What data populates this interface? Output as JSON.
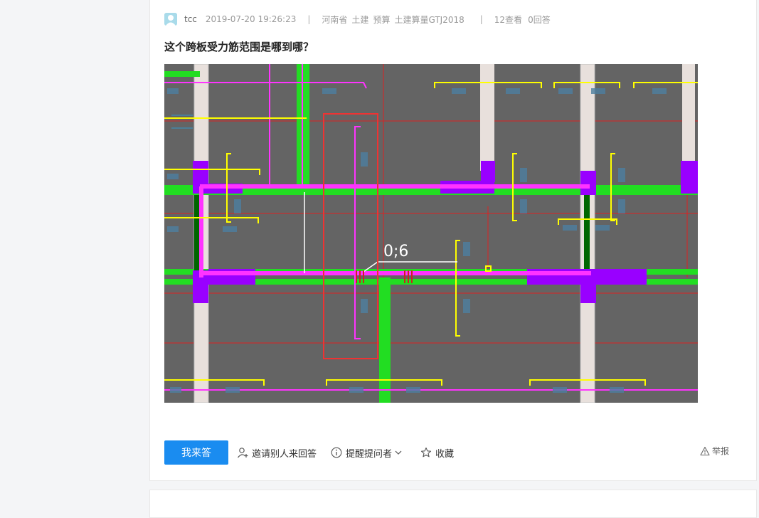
{
  "question": {
    "user": "tcc",
    "datetime": "2019-07-20 19:26:23",
    "region": "河南省",
    "tags": [
      "土建",
      "预算",
      "土建算量GTJ2018"
    ],
    "views": "12查看",
    "answers": "0回答",
    "title": "这个跨板受力筋范围是哪到哪？",
    "drawing_annotation": "0;6"
  },
  "actions": {
    "answer_label": "我来答",
    "invite_label": "邀请别人来回答",
    "remind_label": "提醒提问者",
    "favorite_label": "收藏",
    "report_label": "举报"
  },
  "colors": {
    "accent": "#1a8cf0",
    "drawing_bg": "#646464",
    "beam_green": "#22dd22",
    "rebar_magenta": "#ff33ff",
    "rebar_yellow": "#ffff00",
    "column_purple": "#9900ff",
    "axis_red": "#dd2222"
  }
}
